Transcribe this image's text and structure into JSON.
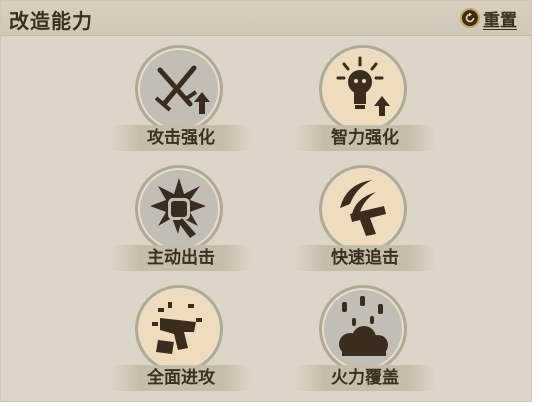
{
  "panel": {
    "title": "改造能力",
    "reset_label": "重置"
  },
  "skills": [
    {
      "label": "攻击强化",
      "icon": "crossed-swords-up-arrow-icon",
      "style": "grey"
    },
    {
      "label": "智力强化",
      "icon": "lightbulb-up-arrow-icon",
      "style": "light"
    },
    {
      "label": "主动出击",
      "icon": "punch-fist-icon",
      "style": "grey"
    },
    {
      "label": "快速追击",
      "icon": "pistol-swoosh-icon",
      "style": "light"
    },
    {
      "label": "全面进攻",
      "icon": "gun-explosion-icon",
      "style": "light"
    },
    {
      "label": "火力覆盖",
      "icon": "bullet-barrage-icon",
      "style": "grey"
    }
  ],
  "colors": {
    "panel_bg": "#dcd6c8",
    "icon_dark": "#3a2c1e",
    "circle_grey": "#c2beb4",
    "circle_light": "#efdcbd"
  }
}
